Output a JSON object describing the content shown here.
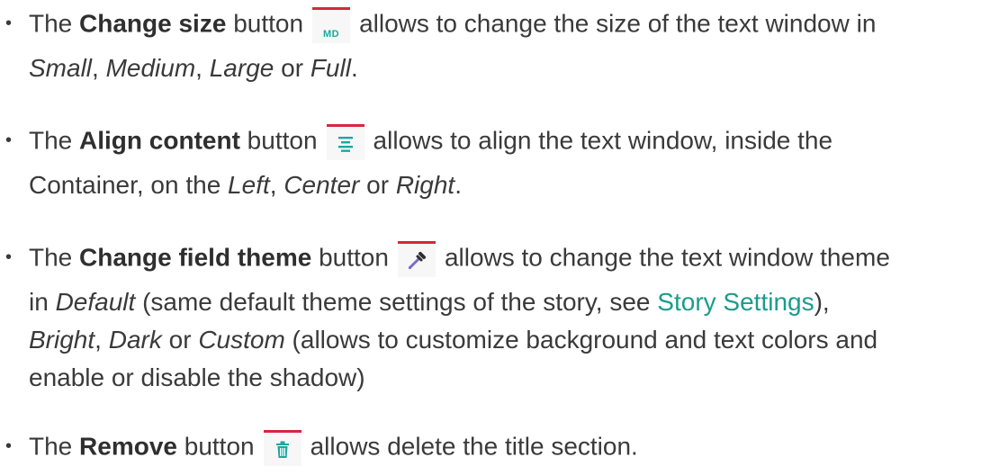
{
  "items": [
    {
      "prefix": "The ",
      "label": "Change size",
      "after_label": " button",
      "icon_text": "MD",
      "line1_rest": "allows to change the size of the text window in",
      "line2": [
        {
          "t": "Small",
          "i": true
        },
        {
          "t": ", "
        },
        {
          "t": "Medium",
          "i": true
        },
        {
          "t": ", "
        },
        {
          "t": "Large",
          "i": true
        },
        {
          "t": " or "
        },
        {
          "t": "Full",
          "i": true
        },
        {
          "t": "."
        }
      ]
    },
    {
      "prefix": "The ",
      "label": "Align content",
      "after_label": " button",
      "icon": "align-center-icon",
      "line1_rest": "allows to align the text window, inside the",
      "line2": [
        {
          "t": "Container, on the "
        },
        {
          "t": "Left",
          "i": true
        },
        {
          "t": ", "
        },
        {
          "t": "Center",
          "i": true
        },
        {
          "t": " or "
        },
        {
          "t": "Right",
          "i": true
        },
        {
          "t": "."
        }
      ]
    },
    {
      "prefix": "The ",
      "label": "Change field theme",
      "after_label": " button",
      "icon": "eyedropper-icon",
      "line1_rest": "allows to change the text window theme",
      "line2_a": "in ",
      "line2_default": "Default",
      "line2_b": " (same default theme settings of the story, see ",
      "link": "Story Settings",
      "line2_c": "),",
      "line3": [
        {
          "t": "Bright",
          "i": true
        },
        {
          "t": ", "
        },
        {
          "t": "Dark",
          "i": true
        },
        {
          "t": " or "
        },
        {
          "t": "Custom",
          "i": true
        },
        {
          "t": " (allows to customize background and text colors and"
        }
      ],
      "line4": "enable or disable the shadow)"
    },
    {
      "prefix": "The ",
      "label": "Remove",
      "after_label": " button",
      "icon": "trash-icon",
      "line1_rest": "allows delete the title section."
    }
  ],
  "colors": {
    "text": "#3a3a3a",
    "accent_teal": "#1aa8a0",
    "link": "#1a9c8c",
    "button_top_border": "#d7263d",
    "button_bg": "#f7f7f7"
  }
}
